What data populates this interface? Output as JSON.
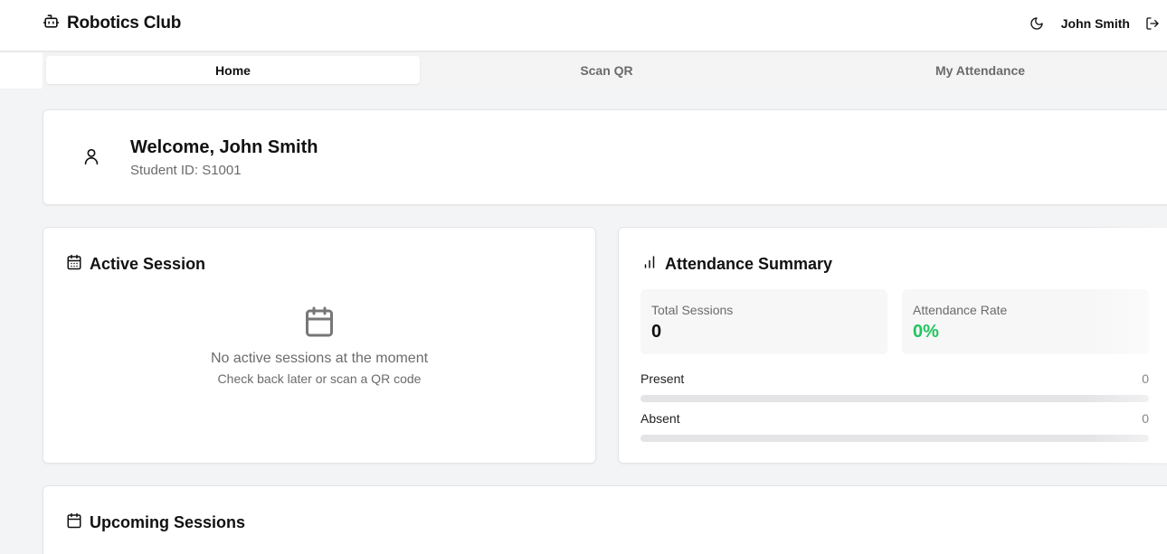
{
  "app": {
    "title": "Robotics Club"
  },
  "header": {
    "user_name": "John Smith",
    "icons": {
      "brand": "robot-icon",
      "theme": "moon-icon",
      "logout": "logout-icon"
    }
  },
  "tabs": [
    {
      "label": "Home",
      "active": true
    },
    {
      "label": "Scan QR",
      "active": false
    },
    {
      "label": "My Attendance",
      "active": false
    }
  ],
  "welcome": {
    "title": "Welcome, John Smith",
    "student_id": "Student ID: S1001",
    "icon": "user-icon"
  },
  "active_session": {
    "title": "Active Session",
    "icon": "calendar-grid-icon",
    "empty_icon": "calendar-icon",
    "empty_message": "No active sessions at the moment",
    "empty_hint": "Check back later or scan a QR code"
  },
  "attendance_summary": {
    "title": "Attendance Summary",
    "icon": "bar-chart-icon",
    "total_sessions_label": "Total Sessions",
    "total_sessions_value": "0",
    "attendance_rate_label": "Attendance Rate",
    "attendance_rate_value": "0%",
    "present_label": "Present",
    "present_count": "0",
    "present_fraction": 0,
    "absent_label": "Absent",
    "absent_count": "0",
    "absent_fraction": 0
  },
  "upcoming": {
    "title": "Upcoming Sessions",
    "icon": "calendar-icon"
  },
  "colors": {
    "accent_green": "#22c55e",
    "bar_track": "#e4e4e7"
  }
}
